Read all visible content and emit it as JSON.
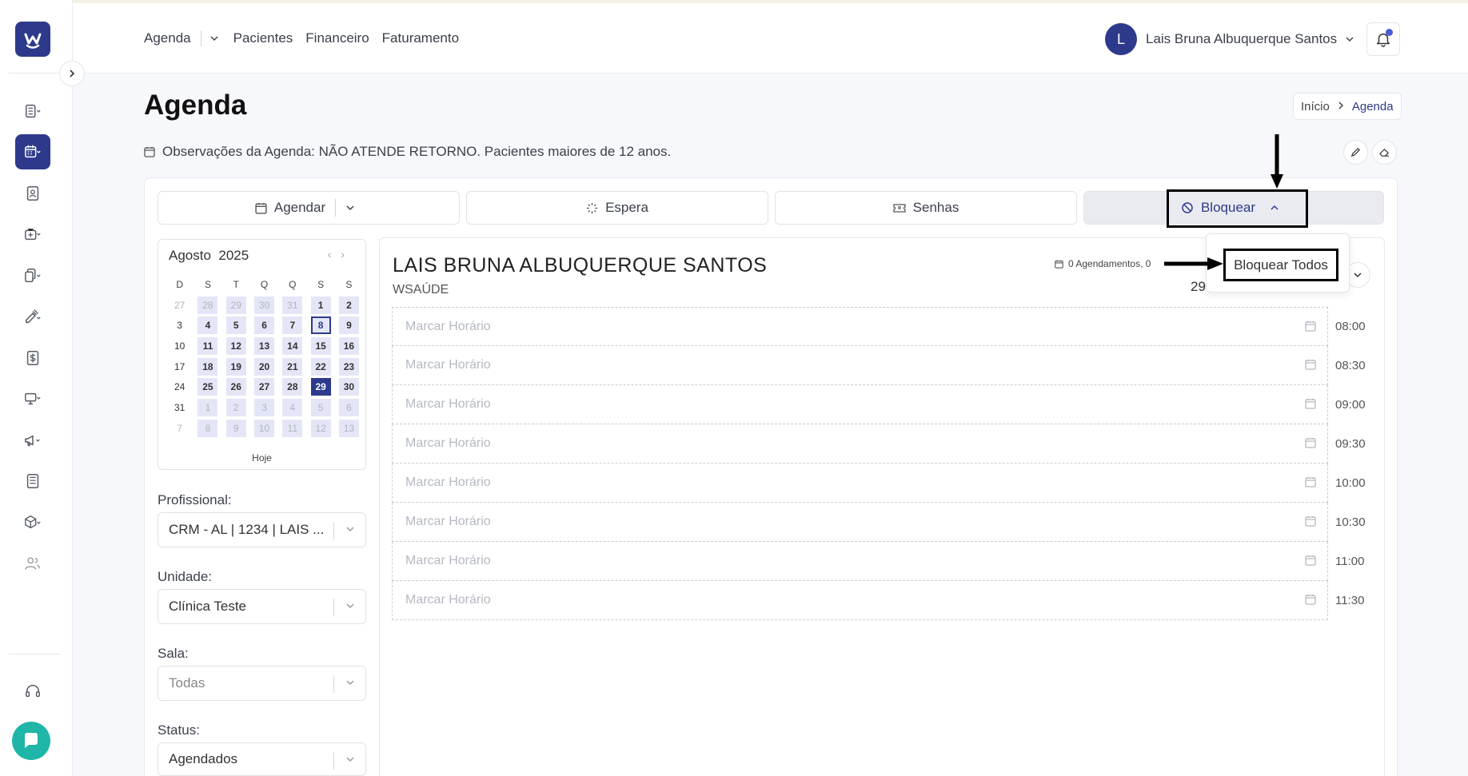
{
  "nav": {
    "agenda": "Agenda",
    "pacientes": "Pacientes",
    "financeiro": "Financeiro",
    "faturamento": "Faturamento"
  },
  "user": {
    "initial": "L",
    "name": "Lais Bruna Albuquerque Santos"
  },
  "page": {
    "title": "Agenda",
    "breadcrumb": {
      "home": "Início",
      "current": "Agenda"
    },
    "observations": "Observações da Agenda: NÃO ATENDE RETORNO. Pacientes maiores de 12 anos."
  },
  "actions": {
    "agendar": "Agendar",
    "espera": "Espera",
    "senhas": "Senhas",
    "bloquear": "Bloquear"
  },
  "dropdown": {
    "bloquear_todos": "Bloquear Todos"
  },
  "calendar": {
    "month": "Agosto",
    "year": "2025",
    "weekdays": [
      "D",
      "S",
      "T",
      "Q",
      "Q",
      "S",
      "S"
    ],
    "weeks": [
      [
        "27",
        "28",
        "29",
        "30",
        "31",
        "1",
        "2"
      ],
      [
        "3",
        "4",
        "5",
        "6",
        "7",
        "8",
        "9"
      ],
      [
        "10",
        "11",
        "12",
        "13",
        "14",
        "15",
        "16"
      ],
      [
        "17",
        "18",
        "19",
        "20",
        "21",
        "22",
        "23"
      ],
      [
        "24",
        "25",
        "26",
        "27",
        "28",
        "29",
        "30"
      ],
      [
        "31",
        "1",
        "2",
        "3",
        "4",
        "5",
        "6"
      ],
      [
        "7",
        "8",
        "9",
        "10",
        "11",
        "12",
        "13"
      ]
    ],
    "today_label": "Hoje"
  },
  "filters": {
    "profissional": {
      "label": "Profissional:",
      "value": "CRM - AL | 1234 | LAIS ..."
    },
    "unidade": {
      "label": "Unidade:",
      "value": "Clínica Teste"
    },
    "sala": {
      "label": "Sala:",
      "value": "Todas"
    },
    "status": {
      "label": "Status:",
      "value": "Agendados"
    }
  },
  "schedule": {
    "doctor": "LAIS BRUNA ALBUQUERQUE SANTOS",
    "unit": "WSAÚDE",
    "count": "0 Agendamentos, 0",
    "date_fragment": "29",
    "slot_label": "Marcar Horário",
    "times": [
      "08:00",
      "08:30",
      "09:00",
      "09:30",
      "10:00",
      "10:30",
      "11:00",
      "11:30"
    ]
  },
  "colors": {
    "primary": "#2d3a8c",
    "chat": "#1fb6a8"
  }
}
